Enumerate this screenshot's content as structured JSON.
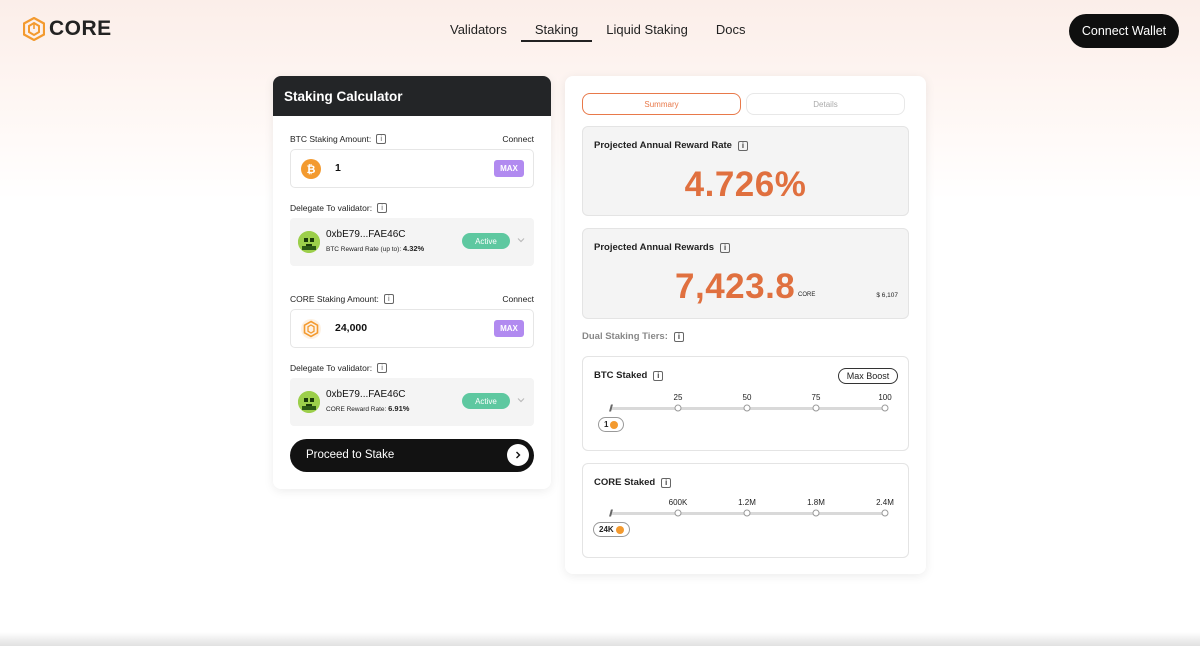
{
  "header": {
    "logo_text": "CORE",
    "nav": [
      "Validators",
      "Staking",
      "Liquid Staking",
      "Docs"
    ],
    "active_nav": "Staking",
    "connect_wallet_label": "Connect Wallet"
  },
  "calculator": {
    "title": "Staking Calculator",
    "btc": {
      "amount_label": "BTC Staking Amount:",
      "connect_label": "Connect",
      "value": "1",
      "max_label": "MAX",
      "delegate_label": "Delegate To validator:",
      "validator_address": "0xbE79...FAE46C",
      "reward_rate_label": "BTC Reward Rate (up to):",
      "reward_rate_value": "4.32%",
      "status": "Active"
    },
    "core": {
      "amount_label": "CORE Staking Amount:",
      "connect_label": "Connect",
      "value": "24,000",
      "max_label": "MAX",
      "delegate_label": "Delegate To validator:",
      "validator_address": "0xbE79...FAE46C",
      "reward_rate_label": "CORE Reward Rate:",
      "reward_rate_value": "6.91%",
      "status": "Active"
    },
    "proceed_label": "Proceed to Stake"
  },
  "summary": {
    "tabs": [
      "Summary",
      "Details"
    ],
    "selected_tab": "Summary",
    "rate_title": "Projected Annual Reward Rate",
    "rate_value": "4.726%",
    "rewards_title": "Projected Annual Rewards",
    "rewards_value": "7,423.8",
    "rewards_unit": "CORE",
    "rewards_usd": "$ 6,107",
    "tiers_label": "Dual Staking Tiers:",
    "btc_tier": {
      "title": "BTC Staked",
      "badge": "Max Boost",
      "ticks": [
        "25",
        "50",
        "75",
        "100"
      ],
      "current": "1",
      "current_fraction": 0.01
    },
    "core_tier": {
      "title": "CORE Staked",
      "ticks": [
        "600K",
        "1.2M",
        "1.8M",
        "2.4M"
      ],
      "current": "24K",
      "current_fraction": 0.01
    }
  },
  "colors": {
    "accent": "#e0703f",
    "max_button": "#b18af0",
    "active_status": "#5ec8a0",
    "dark": "#121212"
  },
  "icons": {
    "logo": "core-hexagon-icon",
    "btc": "bitcoin-icon",
    "core": "core-coin-icon",
    "info": "info-icon",
    "chevron": "chevron-down-icon",
    "arrow": "chevron-right-icon"
  }
}
